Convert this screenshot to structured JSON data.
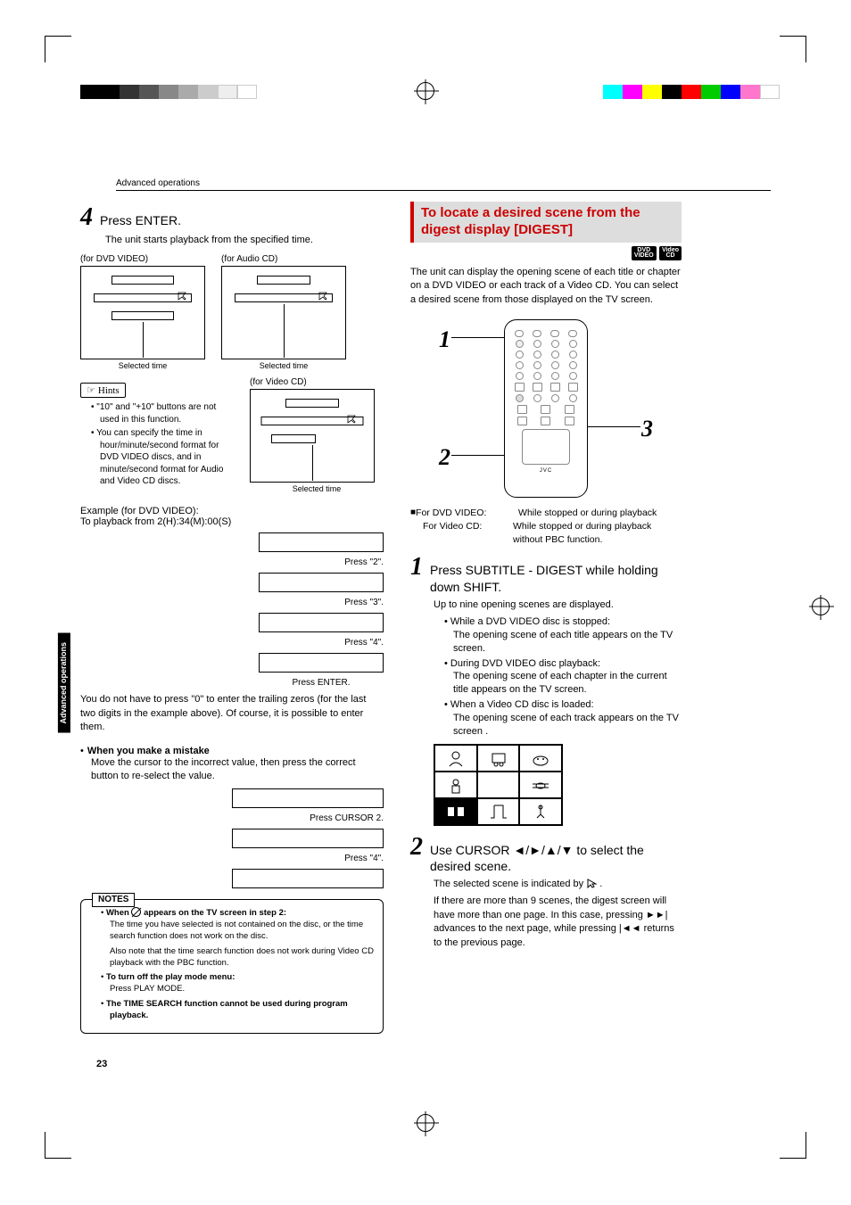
{
  "header": {
    "breadcrumb": "Advanced operations"
  },
  "side_tab": "Advanced\noperations",
  "page_number": "23",
  "left": {
    "step4": {
      "num": "4",
      "title": "Press ENTER.",
      "body": "The unit starts playback from the specified time.",
      "dvd_label": "(for DVD VIDEO)",
      "audio_label": "(for Audio CD)",
      "video_label": "(for Video CD)",
      "selected_time": "Selected time"
    },
    "hints_label": "Hints",
    "hints": [
      "\"10\" and \"+10\" buttons are not used in this function.",
      "You can specify the time in hour/minute/second format for DVD VIDEO discs, and in minute/second format for Audio and Video CD discs."
    ],
    "example_title": "Example (for DVD VIDEO):",
    "example_sub": "To playback from 2(H):34(M):00(S)",
    "seq": {
      "p2": "Press \"2\".",
      "p3": "Press \"3\".",
      "p4": "Press \"4\".",
      "enter": "Press ENTER."
    },
    "trailing": "You do not have to press \"0\" to enter the trailing zeros (for the last two digits in the example above). Of course, it is possible to enter them.",
    "mistake": {
      "title": "When you make a mistake",
      "body": "Move the cursor to the incorrect value, then press the correct button to re-select the value.",
      "cursor": "Press CURSOR 2.",
      "p4": "Press \"4\"."
    },
    "notes_title": "NOTES",
    "notes": {
      "n1_lead": "When ",
      "n1_tail": " appears on the TV screen in step 2:",
      "n1_body1": "The time you have selected is not contained on the disc, or the time search function does not work on the disc.",
      "n1_body2": "Also note that the time search function does not work during Video CD playback with the PBC function.",
      "n2_lead": "To turn off the play mode menu:",
      "n2_body": "Press PLAY MODE.",
      "n3": "The TIME SEARCH function cannot be used during program playback."
    }
  },
  "right": {
    "section_title_1": "To locate a desired scene from the",
    "section_title_2": "digest display [DIGEST]",
    "badge1": "DVD VIDEO",
    "badge2": "Video CD",
    "intro": "The unit can display the opening scene of each title or chapter on a DVD VIDEO or each track of a Video CD. You can select a desired scene from those displayed on the TV screen.",
    "callouts": {
      "c1": "1",
      "c2": "2",
      "c3": "3"
    },
    "remote_brand": "JVC",
    "conditions": {
      "dvd_label": "For DVD VIDEO:",
      "dvd_val": "While stopped or during playback",
      "vcd_label": "For Video CD:",
      "vcd_val": "While stopped or during playback without PBC function."
    },
    "step1": {
      "num": "1",
      "title": "Press SUBTITLE - DIGEST while holding down SHIFT.",
      "body": "Up to nine opening scenes are displayed.",
      "items": [
        {
          "lead": "While a DVD VIDEO disc is stopped:",
          "body": "The opening scene of each title appears on the TV screen."
        },
        {
          "lead": "During DVD VIDEO disc playback:",
          "body": "The opening scene of each chapter in the current title appears on the TV screen."
        },
        {
          "lead": "When a Video CD disc is loaded:",
          "body": "The opening scene of each track appears on the TV screen ."
        }
      ]
    },
    "step2": {
      "num": "2",
      "title_pre": "Use CURSOR ",
      "title_post": " to select the desired scene.",
      "body_pre": "The selected scene is indicated by ",
      "body_post": ".",
      "more1_pre": "If there are more than 9 scenes, the digest screen will have more than one page. In this case, pressing ",
      "more1_mid": " advances to the next page, while pressing ",
      "more1_post": " returns to the previous page."
    }
  }
}
